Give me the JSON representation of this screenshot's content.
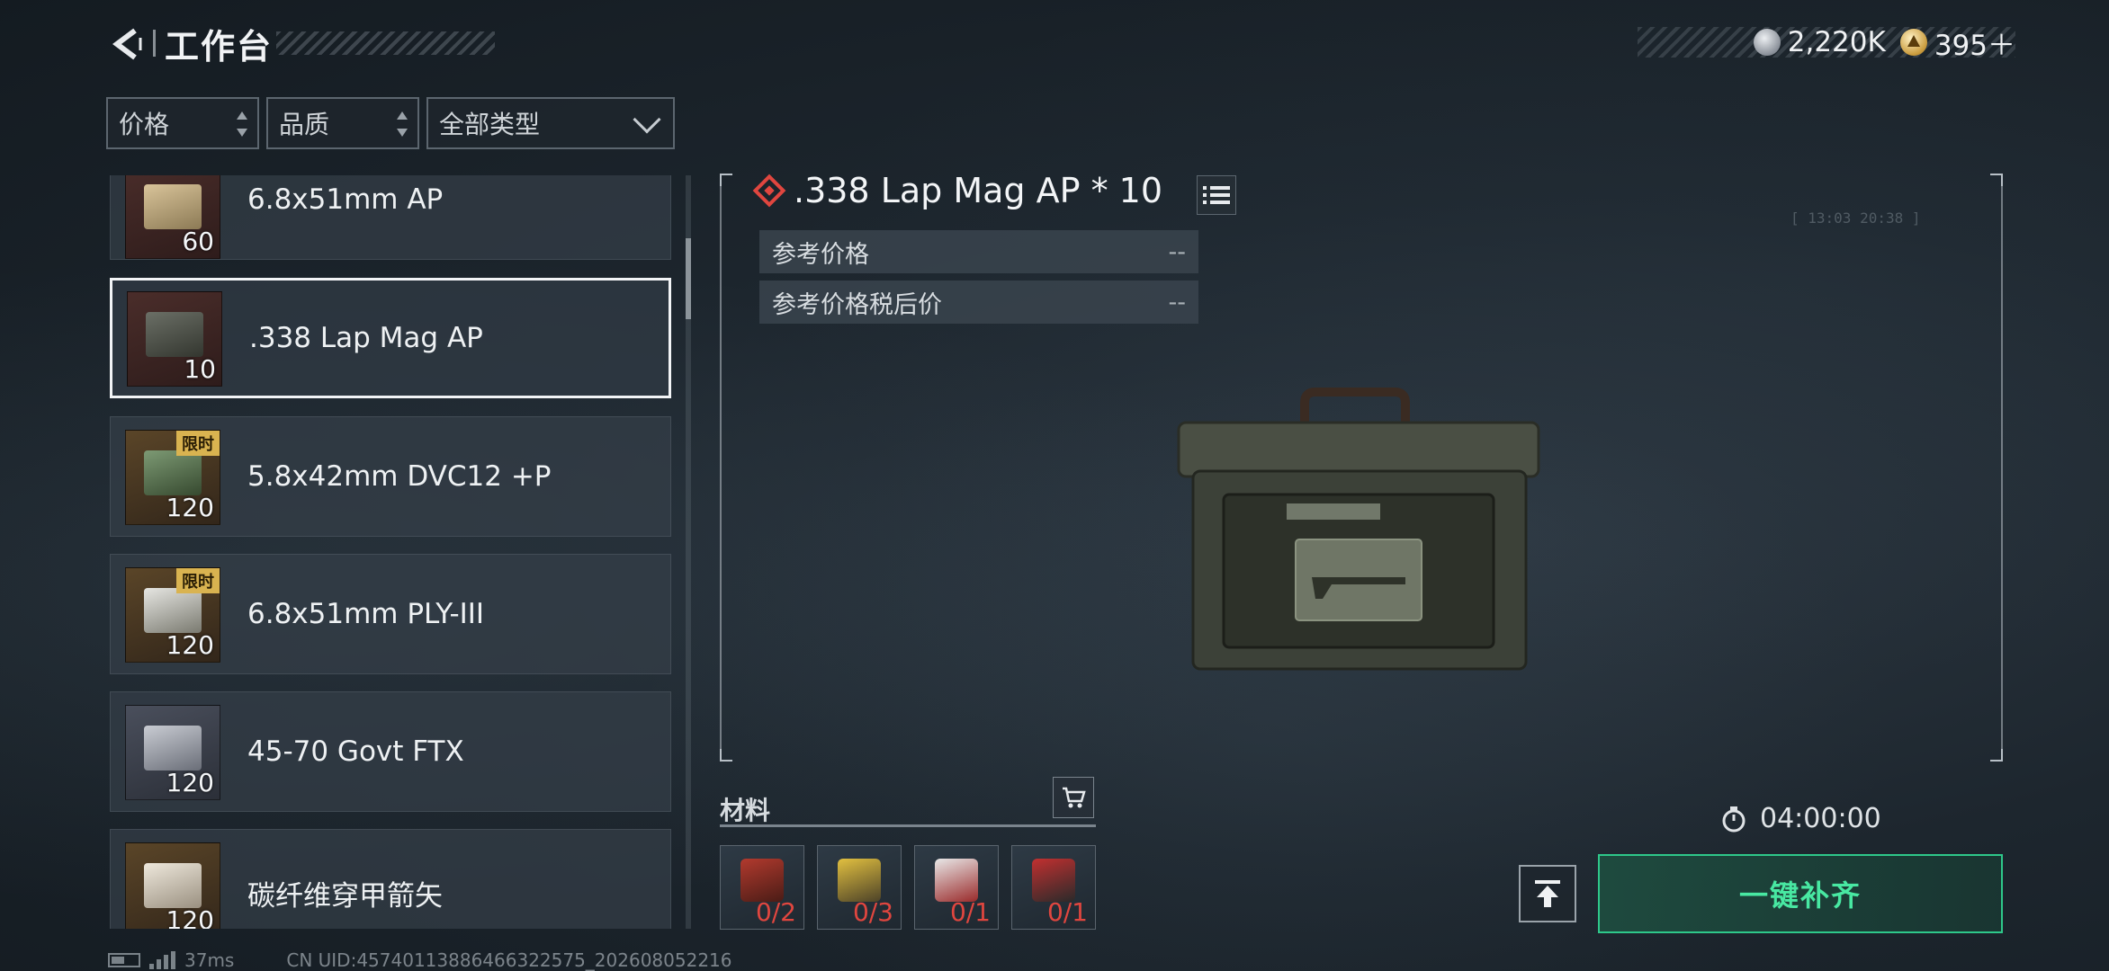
{
  "header": {
    "title": "工作台",
    "currencies": [
      {
        "icon": "silver-coin-icon",
        "value": "2,220K"
      },
      {
        "icon": "gold-coin-icon",
        "value": "395＋"
      }
    ]
  },
  "filters": {
    "price": "价格",
    "quality": "品质",
    "type": "全部类型"
  },
  "items": [
    {
      "name": "6.8x51mm AP",
      "qty": "60",
      "tag": ""
    },
    {
      "name": ".338 Lap Mag AP",
      "qty": "10",
      "tag": "",
      "selected": true
    },
    {
      "name": "5.8x42mm DVC12 +P",
      "qty": "120",
      "tag": "限时"
    },
    {
      "name": "6.8x51mm PLY-III",
      "qty": "120",
      "tag": "限时"
    },
    {
      "name": "45-70 Govt FTX",
      "qty": "120",
      "tag": ""
    },
    {
      "name": "碳纤维穿甲箭矢",
      "qty": "120",
      "tag": ""
    }
  ],
  "detail": {
    "title": ".338 Lap Mag AP * 10",
    "ref_price_label": "参考价格",
    "ref_price_value": "--",
    "ref_price_tax_label": "参考价格税后价",
    "ref_price_tax_value": "--",
    "hud_readout": "[ 13:03    20:38 ]"
  },
  "materials": {
    "label": "材料",
    "slots": [
      {
        "icon": "red-parts-icon",
        "count": "0/2"
      },
      {
        "icon": "yellow-tool-icon",
        "count": "0/3"
      },
      {
        "icon": "card-icon",
        "count": "0/1"
      },
      {
        "icon": "canister-icon",
        "count": "0/1"
      }
    ]
  },
  "timer": "04:00:00",
  "actions": {
    "main_button": "一键补齐"
  },
  "status": {
    "ping": "37ms",
    "uid": "CN UID:457401138864663225​75_202608052216"
  },
  "colors": {
    "accent_green": "#2ec88a",
    "alert_red": "#e0463f",
    "limited_tag": "#d9b350"
  }
}
